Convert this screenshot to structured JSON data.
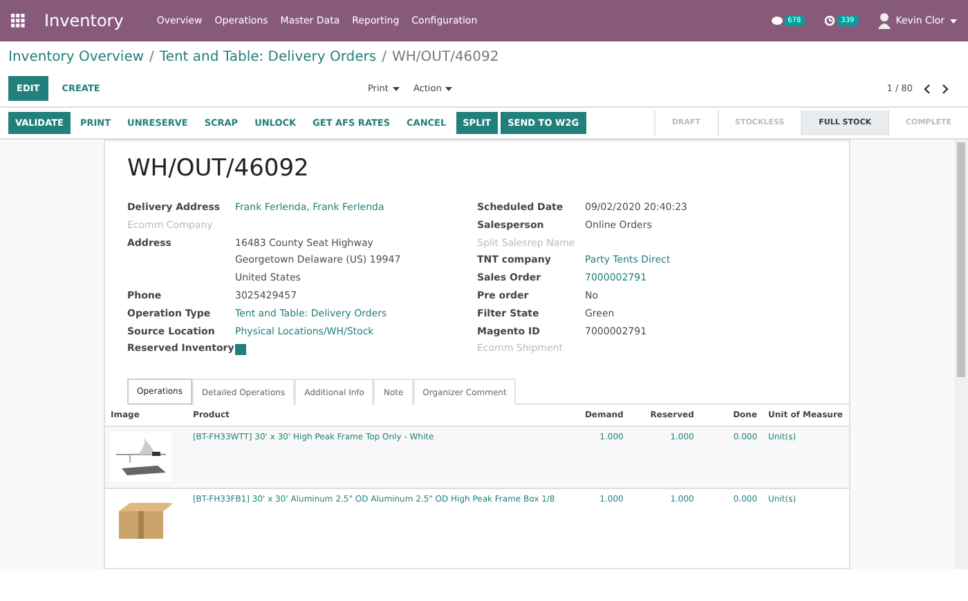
{
  "navbar": {
    "app": "Inventory",
    "menu": [
      "Overview",
      "Operations",
      "Master Data",
      "Reporting",
      "Configuration"
    ],
    "messages_badge": "678",
    "activities_badge": "339",
    "user": "Kevin Clor"
  },
  "breadcrumb_separators": [
    "/",
    "/"
  ],
  "breadcrumb": [
    {
      "label": "Inventory Overview",
      "link": true
    },
    {
      "label": "Tent and Table: Delivery Orders",
      "link": true
    },
    {
      "label": "WH/OUT/46092",
      "link": false
    }
  ],
  "control_buttons": [
    {
      "label": "EDIT",
      "kind": "primary"
    },
    {
      "label": "CREATE",
      "kind": "plain"
    }
  ],
  "dropdowns": [
    "Print",
    "Action"
  ],
  "pager": "1 / 80",
  "action_buttons": [
    {
      "label": "VALIDATE",
      "kind": "primary"
    },
    {
      "label": "PRINT",
      "kind": "plain"
    },
    {
      "label": "UNRESERVE",
      "kind": "plain"
    },
    {
      "label": "SCRAP",
      "kind": "plain"
    },
    {
      "label": "UNLOCK",
      "kind": "plain"
    },
    {
      "label": "GET AFS RATES",
      "kind": "plain"
    },
    {
      "label": "CANCEL",
      "kind": "plain"
    },
    {
      "label": "SPLIT",
      "kind": "primary"
    },
    {
      "label": "SEND TO W2G",
      "kind": "primary"
    }
  ],
  "stages": [
    {
      "label": "DRAFT",
      "selected": false
    },
    {
      "label": "STOCKLESS",
      "selected": false
    },
    {
      "label": "FULL STOCK",
      "selected": true
    },
    {
      "label": "COMPLETE",
      "selected": false
    }
  ],
  "title": "WH/OUT/46092",
  "left_fields": [
    {
      "label": "Delivery Address",
      "muted": false,
      "kind": "link",
      "lines": [
        "Frank Ferlenda, Frank Ferlenda"
      ]
    },
    {
      "label": "Ecomm Company",
      "muted": true,
      "kind": "text"
    },
    {
      "label": "Address",
      "muted": false,
      "kind": "text",
      "lines": [
        "16483 County Seat Highway",
        "Georgetown  Delaware (US)  19947",
        "United States"
      ]
    },
    {
      "label": "Phone",
      "muted": false,
      "kind": "text",
      "lines": [
        "3025429457"
      ]
    },
    {
      "label": "Operation Type",
      "muted": false,
      "kind": "link",
      "lines": [
        "Tent and Table: Delivery Orders"
      ]
    },
    {
      "label": "Source Location",
      "muted": false,
      "kind": "link",
      "lines": [
        "Physical Locations/WH/Stock"
      ]
    },
    {
      "label": "Reserved Inventory",
      "muted": false,
      "kind": "checkbox",
      "checked": true
    }
  ],
  "right_fields": [
    {
      "label": "Scheduled Date",
      "muted": false,
      "kind": "text",
      "lines": [
        "09/02/2020 20:40:23"
      ]
    },
    {
      "label": "Salesperson",
      "muted": false,
      "kind": "text",
      "lines": [
        "Online Orders"
      ]
    },
    {
      "label": "Split Salesrep Name",
      "muted": true,
      "kind": "text"
    },
    {
      "label": "TNT company",
      "muted": false,
      "kind": "link",
      "lines": [
        "Party Tents Direct"
      ]
    },
    {
      "label": "Sales Order",
      "muted": false,
      "kind": "link",
      "lines": [
        "7000002791"
      ]
    },
    {
      "label": "Pre order",
      "muted": false,
      "kind": "text",
      "lines": [
        "No"
      ]
    },
    {
      "label": "Filter State",
      "muted": false,
      "kind": "text",
      "lines": [
        "Green"
      ]
    },
    {
      "label": "Magento ID",
      "muted": false,
      "kind": "text",
      "lines": [
        "7000002791"
      ]
    },
    {
      "label": "Ecomm Shipment",
      "muted": true,
      "kind": "text"
    }
  ],
  "tabs": [
    {
      "label": "Operations",
      "selected": true
    },
    {
      "label": "Detailed Operations",
      "selected": false
    },
    {
      "label": "Additional Info",
      "selected": false
    },
    {
      "label": "Note",
      "selected": false
    },
    {
      "label": "Organizer Comment",
      "selected": false
    }
  ],
  "table": {
    "columns": [
      "Image",
      "Product",
      "Demand",
      "Reserved",
      "Done",
      "Unit of Measure"
    ],
    "rows": [
      {
        "product": "[BT-FH33WTT] 30' x 30' High Peak Frame Top Only - White",
        "demand": "1.000",
        "reserved": "1.000",
        "done": "0.000",
        "uom": "Unit(s)"
      },
      {
        "product": "[BT-FH33FB1] 30' x 30' Aluminum 2.5\" OD Aluminum 2.5\" OD High Peak Frame Box 1/8",
        "demand": "1.000",
        "reserved": "1.000",
        "done": "0.000",
        "uom": "Unit(s)"
      }
    ]
  }
}
